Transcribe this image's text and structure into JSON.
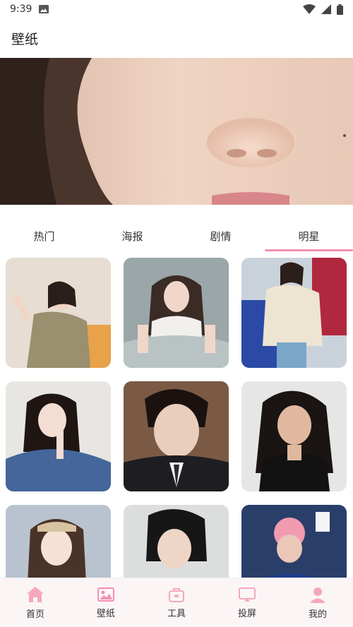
{
  "status_bar": {
    "time": "9:39"
  },
  "app_bar": {
    "title": "壁纸"
  },
  "tabs": [
    {
      "label": "热门",
      "active": false
    },
    {
      "label": "海报",
      "active": false
    },
    {
      "label": "剧情",
      "active": false
    },
    {
      "label": "明星",
      "active": true
    }
  ],
  "wallpapers": [
    {
      "name": "wallpaper-1"
    },
    {
      "name": "wallpaper-2"
    },
    {
      "name": "wallpaper-3"
    },
    {
      "name": "wallpaper-4"
    },
    {
      "name": "wallpaper-5"
    },
    {
      "name": "wallpaper-6"
    },
    {
      "name": "wallpaper-7"
    },
    {
      "name": "wallpaper-8"
    },
    {
      "name": "wallpaper-9"
    }
  ],
  "bottom_nav": [
    {
      "label": "首页",
      "icon": "home-icon"
    },
    {
      "label": "壁纸",
      "icon": "image-icon"
    },
    {
      "label": "工具",
      "icon": "toolbox-icon"
    },
    {
      "label": "投屏",
      "icon": "cast-icon"
    },
    {
      "label": "我的",
      "icon": "profile-icon"
    }
  ],
  "colors": {
    "accent": "#f38fb4",
    "nav_bg": "#fbf5f6"
  }
}
